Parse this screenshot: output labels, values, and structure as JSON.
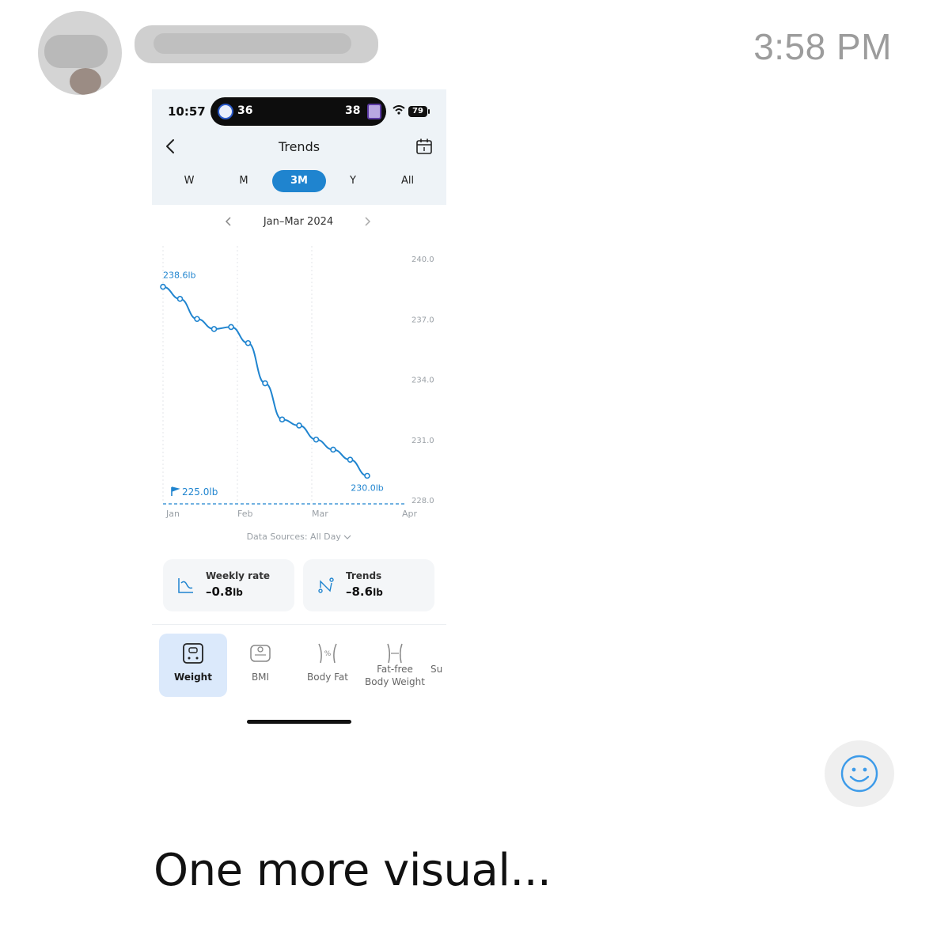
{
  "message": {
    "time": "3:58 PM",
    "caption": "One more visual..."
  },
  "phone": {
    "status_bar": {
      "time": "10:57",
      "score_home": "36",
      "score_away": "38",
      "battery": "79"
    },
    "nav": {
      "title": "Trends"
    },
    "tabs": [
      {
        "label": "W"
      },
      {
        "label": "M"
      },
      {
        "label": "3M",
        "active": true
      },
      {
        "label": "Y"
      },
      {
        "label": "All"
      }
    ],
    "range_label": "Jan–Mar 2024",
    "data_sources": "Data Sources: All Day",
    "cards": [
      {
        "label": "Weekly rate",
        "value": "–0.8",
        "unit": "lb"
      },
      {
        "label": "Trends",
        "value": "–8.6",
        "unit": "lb"
      }
    ],
    "bottom_tabs": [
      {
        "label": "Weight",
        "active": true
      },
      {
        "label": "BMI"
      },
      {
        "label": "Body Fat"
      },
      {
        "label_line1": "Fat-free",
        "label_line2": "Body Weight"
      },
      {
        "label": "Su"
      }
    ],
    "colors": {
      "accent": "#1f84cf",
      "line": "#1f84cf"
    }
  },
  "chart_data": {
    "type": "line",
    "x_labels": [
      "Jan",
      "Feb",
      "Mar",
      "Apr"
    ],
    "ylim": [
      228.0,
      240.0
    ],
    "y_ticks": [
      "240.0",
      "237.0",
      "234.0",
      "231.0",
      "228.0"
    ],
    "series": [
      {
        "values": [
          238.6,
          238.0,
          237.0,
          236.5,
          236.6,
          235.8,
          233.8,
          232.0,
          231.7,
          231.0,
          230.5,
          230.0,
          229.2
        ]
      }
    ],
    "annotations": {
      "start_label": "238.6lb",
      "end_label": "230.0lb",
      "goal_label": "225.0lb"
    },
    "goal_line": "dashed",
    "grid": "vertical-dotted"
  }
}
